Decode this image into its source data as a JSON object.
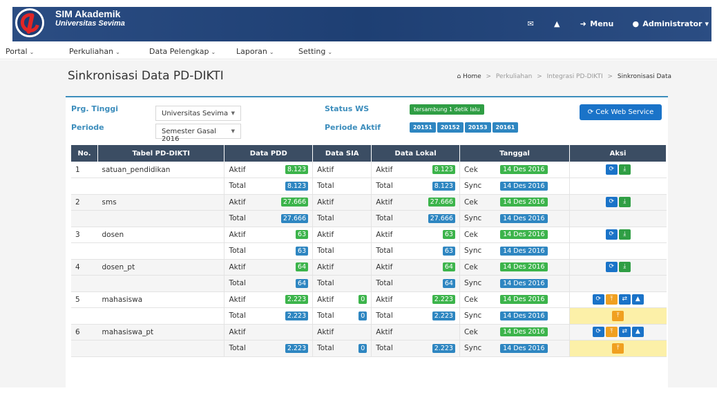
{
  "header": {
    "app_title": "SIM Akademik",
    "app_subtitle": "Universitas Sevima",
    "menu_label": "Menu",
    "user_label": "Administrator",
    "icons": [
      "envelope-icon",
      "warning-icon",
      "sign-in-icon",
      "user-icon"
    ]
  },
  "menubar": {
    "items": [
      "Portal",
      "Perkuliahan",
      "Data Pelengkap",
      "Laporan",
      "Setting"
    ]
  },
  "page": {
    "title": "Sinkronisasi Data PD-DIKTI",
    "breadcrumb": [
      "Home",
      "Perkuliahan",
      "Integrasi PD-DIKTI",
      "Sinkronisasi Data"
    ]
  },
  "filters": {
    "prg_tinggi_label": "Prg. Tinggi",
    "prg_tinggi_value": "Universitas Sevima",
    "periode_label": "Periode",
    "periode_value": "Semester Gasal 2016",
    "status_ws_label": "Status WS",
    "status_ws_value": "tersambung 1 detik lalu",
    "periode_aktif_label": "Periode Aktif",
    "periode_aktif_values": [
      "20151",
      "20152",
      "20153",
      "20161"
    ],
    "cek_button": "Cek Web Service"
  },
  "table": {
    "headers": [
      "No.",
      "Tabel PD-DIKTI",
      "Data PDD",
      "Data SIA",
      "Data Lokal",
      "Tanggal",
      "Aksi"
    ],
    "aktif_label": "Aktif",
    "total_label": "Total",
    "cek_label": "Cek",
    "sync_label": "Sync",
    "rows": [
      {
        "no": "1",
        "name": "satuan_pendidikan",
        "pdd_aktif": "8.123",
        "pdd_total": "8.123",
        "sia_aktif": "",
        "sia_total": "",
        "lokal_aktif": "8.123",
        "lokal_total": "8.123",
        "cek_date": "14 Des 2016",
        "sync_date": "14 Des 2016"
      },
      {
        "no": "2",
        "name": "sms",
        "pdd_aktif": "27.666",
        "pdd_total": "27.666",
        "sia_aktif": "",
        "sia_total": "",
        "lokal_aktif": "27.666",
        "lokal_total": "27.666",
        "cek_date": "14 Des 2016",
        "sync_date": "14 Des 2016"
      },
      {
        "no": "3",
        "name": "dosen",
        "pdd_aktif": "63",
        "pdd_total": "63",
        "sia_aktif": "",
        "sia_total": "",
        "lokal_aktif": "63",
        "lokal_total": "63",
        "cek_date": "14 Des 2016",
        "sync_date": "14 Des 2016"
      },
      {
        "no": "4",
        "name": "dosen_pt",
        "pdd_aktif": "64",
        "pdd_total": "64",
        "sia_aktif": "",
        "sia_total": "",
        "lokal_aktif": "64",
        "lokal_total": "64",
        "cek_date": "14 Des 2016",
        "sync_date": "14 Des 2016"
      },
      {
        "no": "5",
        "name": "mahasiswa",
        "pdd_aktif": "2.223",
        "pdd_total": "2.223",
        "sia_aktif": "0",
        "sia_total": "0",
        "lokal_aktif": "2.223",
        "lokal_total": "2.223",
        "cek_date": "14 Des 2016",
        "sync_date": "14 Des 2016"
      },
      {
        "no": "6",
        "name": "mahasiswa_pt",
        "pdd_aktif": "",
        "pdd_total": "2.223",
        "sia_aktif": "",
        "sia_total": "0",
        "lokal_aktif": "",
        "lokal_total": "2.223",
        "cek_date": "14 Des 2016",
        "sync_date": "14 Des 2016"
      }
    ]
  },
  "colors": {
    "header_bg": "#1e3f73",
    "table_header_bg": "#3b4d63",
    "green": "#3cb44b",
    "blue": "#2e86c1",
    "orange": "#f0a020",
    "yellow_highlight": "#fcf0a8"
  }
}
